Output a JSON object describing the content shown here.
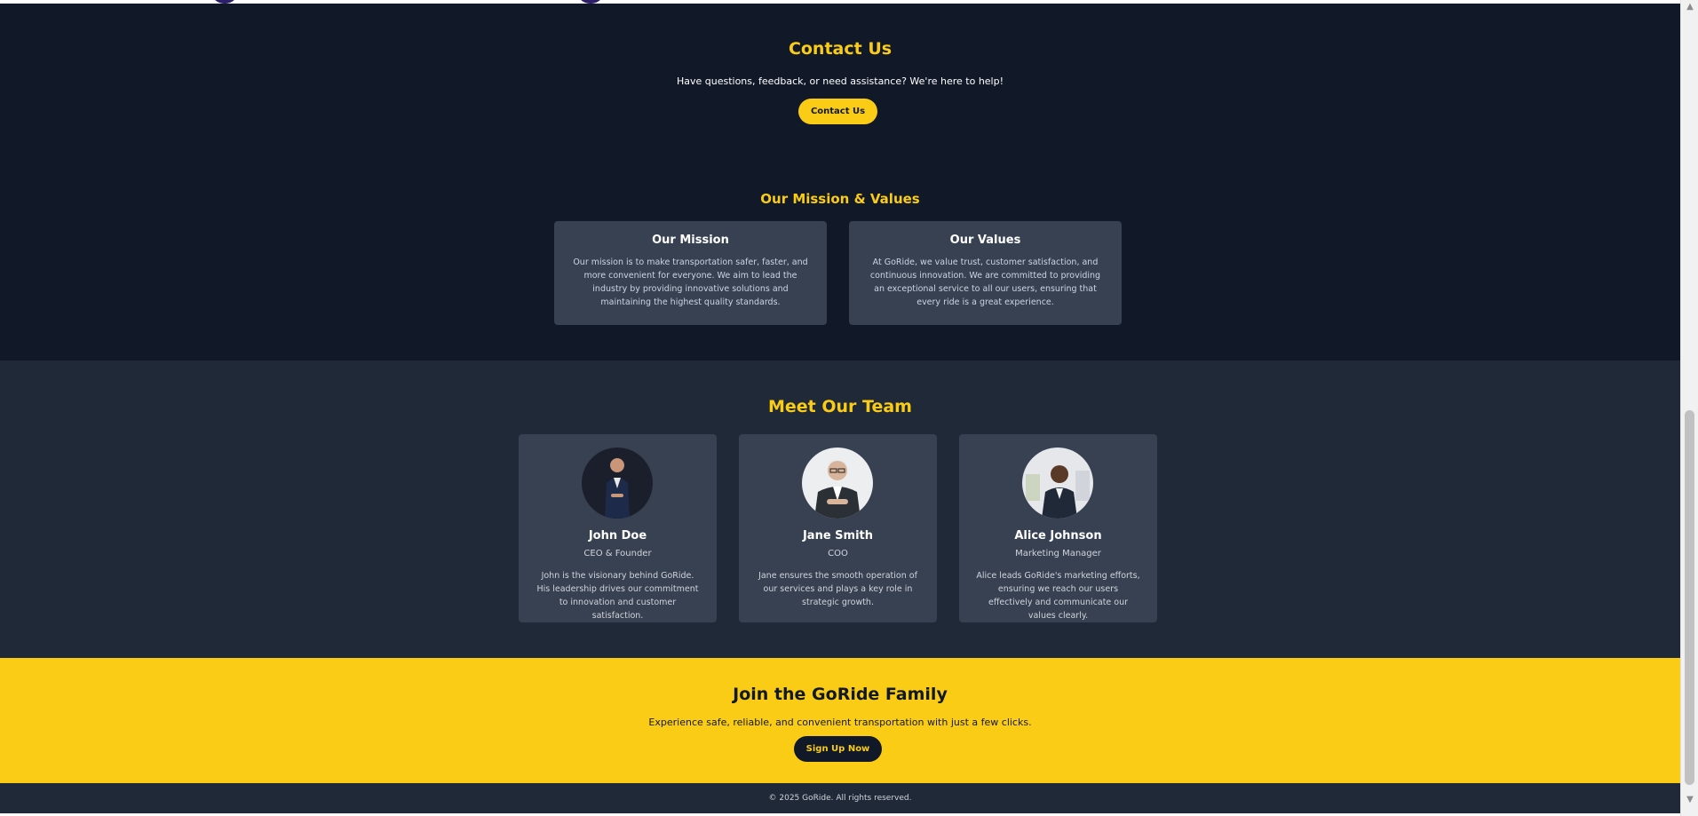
{
  "contact": {
    "title": "Contact Us",
    "text": "Have questions, feedback, or need assistance? We're here to help!",
    "button_label": "Contact Us"
  },
  "mission": {
    "title": "Our Mission & Values",
    "cards": [
      {
        "title": "Our Mission",
        "text": "Our mission is to make transportation safer, faster, and more convenient for everyone. We aim to lead the industry by providing innovative solutions and maintaining the highest quality standards."
      },
      {
        "title": "Our Values",
        "text": "At GoRide, we value trust, customer satisfaction, and continuous innovation. We are committed to providing an exceptional service to all our users, ensuring that every ride is a great experience."
      }
    ]
  },
  "team": {
    "title": "Meet Our Team",
    "members": [
      {
        "name": "John Doe",
        "role": "CEO & Founder",
        "bio": "John is the visionary behind GoRide. His leadership drives our commitment to innovation and customer satisfaction."
      },
      {
        "name": "Jane Smith",
        "role": "COO",
        "bio": "Jane ensures the smooth operation of our services and plays a key role in strategic growth."
      },
      {
        "name": "Alice Johnson",
        "role": "Marketing Manager",
        "bio": "Alice leads GoRide's marketing efforts, ensuring we reach our users effectively and communicate our values clearly."
      }
    ]
  },
  "join": {
    "title": "Join the GoRide Family",
    "text": "Experience safe, reliable, and convenient transportation with just a few clicks.",
    "button_label": "Sign Up Now"
  },
  "footer": {
    "text": "© 2025 GoRide. All rights reserved."
  },
  "scrollbar": {
    "up_icon": "▲",
    "down_icon": "▼"
  },
  "colors": {
    "accent": "#facc15",
    "dark_bg": "#111827",
    "section_bg": "#1f2937",
    "card_bg": "#374151"
  }
}
